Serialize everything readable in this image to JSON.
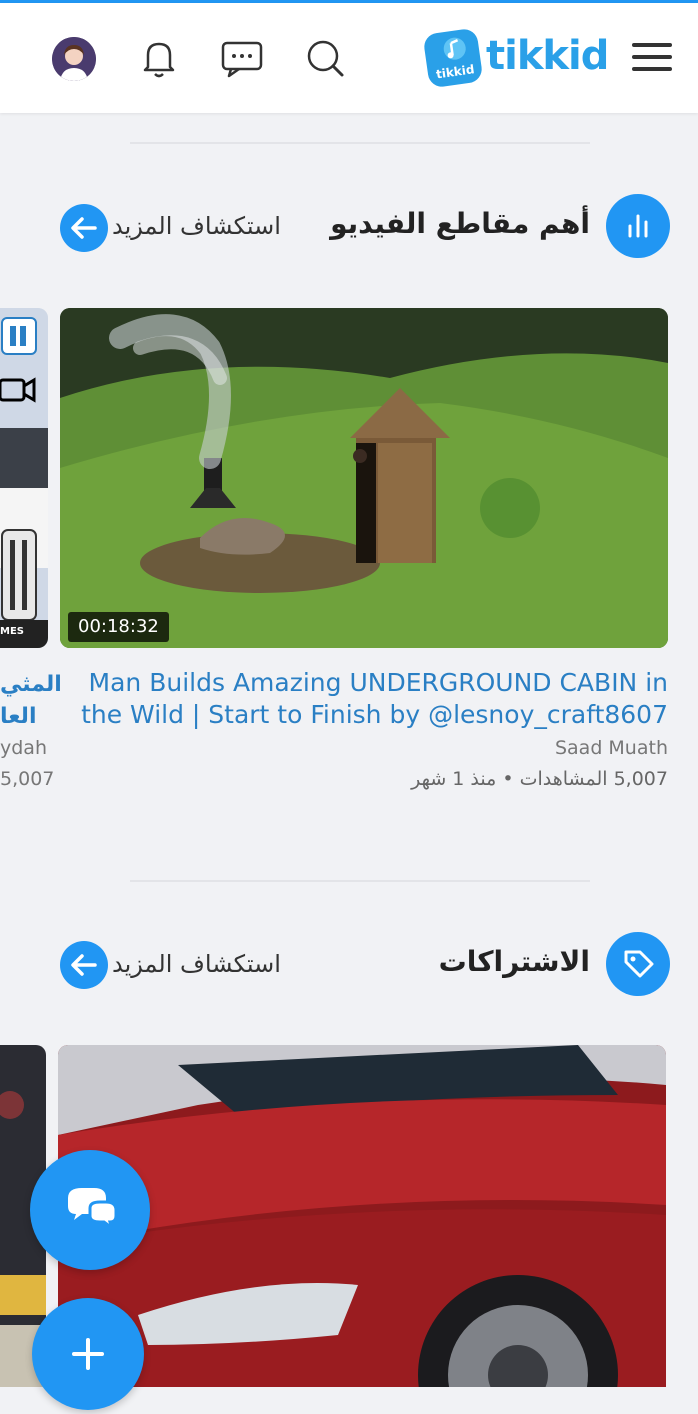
{
  "header": {
    "logo_text": "tikkid",
    "logo_badge_text": "tikkid",
    "icons": [
      "avatar",
      "bell-icon",
      "chat-icon",
      "search-icon",
      "menu-icon"
    ]
  },
  "sections": {
    "top_videos": {
      "title": "أهم مقاطع الفيديو",
      "more_label": "استكشاف المزيد"
    },
    "subscriptions": {
      "title": "الاشتراكات",
      "more_label": "استكشاف المزيد"
    }
  },
  "video": {
    "duration": "00:18:32",
    "title_line1": "Man Builds Amazing UNDERGROUND CABIN in",
    "title_line2": "the Wild | Start to Finish by @lesnoy_craft8607",
    "channel": "Saad Muath",
    "meta": "5,007 المشاهدات • منذ 1 شهر"
  },
  "side_video": {
    "title_line1": "المثي",
    "title_line2": "العا",
    "channel": "ydah",
    "views": "5,007",
    "badge": "MES"
  },
  "colors": {
    "accent": "#2196f3",
    "link": "#2a7fc4"
  }
}
